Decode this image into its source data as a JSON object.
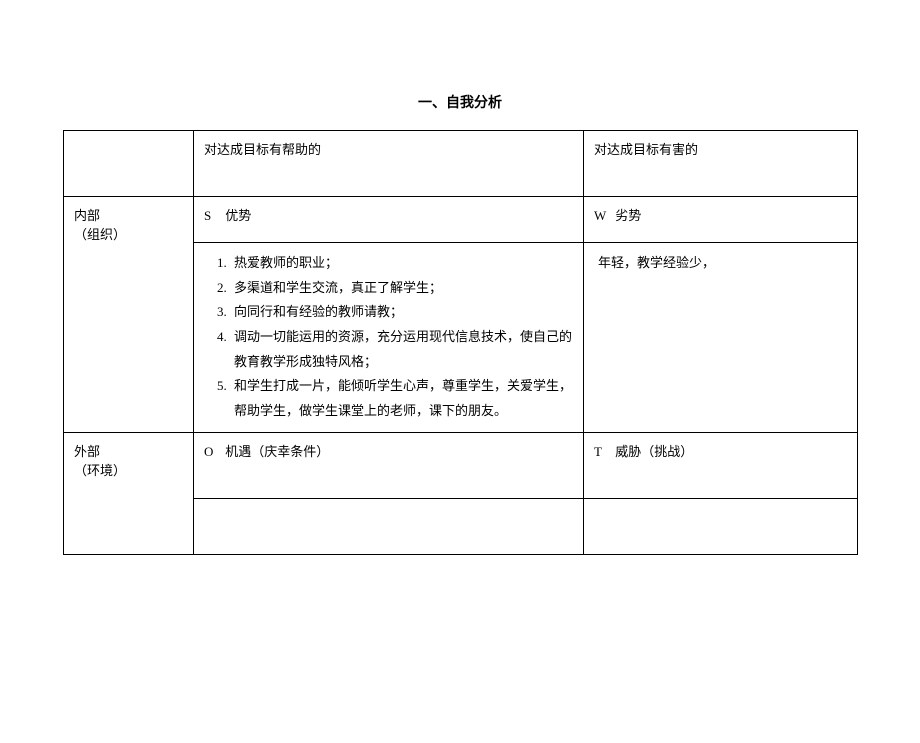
{
  "title": "一、自我分析",
  "header": {
    "helpful": "对达成目标有帮助的",
    "harmful": "对达成目标有害的"
  },
  "internal": {
    "label_line1": "内部",
    "label_line2": "（组织）",
    "s_letter": "S",
    "s_label": "优势",
    "w_letter": "W",
    "w_label": "劣势",
    "strengths": {
      "item1": "热爱教师的职业；",
      "item2": "多渠道和学生交流，真正了解学生；",
      "item3": "向同行和有经验的教师请教；",
      "item4": "调动一切能运用的资源，充分运用现代信息技术，使自己的教育教学形成独特风格；",
      "item5": "和学生打成一片，能倾听学生心声，尊重学生，关爱学生，帮助学生，做学生课堂上的老师，课下的朋友。"
    },
    "weaknesses": "年轻，教学经验少，"
  },
  "external": {
    "label_line1": "外部",
    "label_line2": "（环境）",
    "o_letter": "O",
    "o_label": "机遇（庆幸条件）",
    "t_letter": "T",
    "t_label": "威胁（挑战）"
  }
}
